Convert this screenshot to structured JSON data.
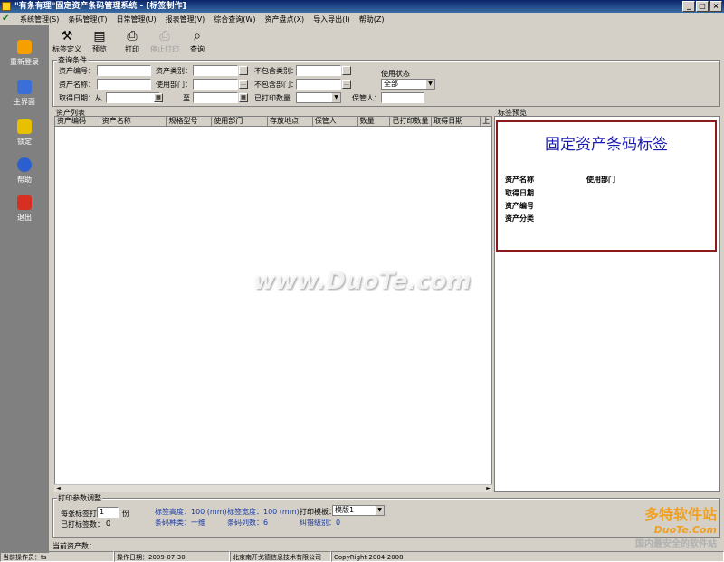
{
  "window": {
    "title": "\"有条有理\"固定资产条码管理系统 - [标签制作]",
    "buttons": [
      "_",
      "□",
      "×"
    ]
  },
  "menu": [
    "系统管理(S)",
    "条码管理(T)",
    "日常管理(U)",
    "报表管理(V)",
    "综合查询(W)",
    "资产盘点(X)",
    "导入导出(I)",
    "帮助(Z)"
  ],
  "sidebar": [
    {
      "label": "重新登录",
      "icon": "login-icon",
      "color": "#f5a000"
    },
    {
      "label": "主界面",
      "icon": "home-icon",
      "color": "#3a6fd8"
    },
    {
      "label": "锁定",
      "icon": "lock-icon",
      "color": "#e8c000"
    },
    {
      "label": "帮助",
      "icon": "help-icon",
      "color": "#2b5fd0"
    },
    {
      "label": "退出",
      "icon": "exit-icon",
      "color": "#d83020"
    }
  ],
  "toolbar": [
    {
      "label": "标签定义",
      "icon": "tools-icon",
      "glyph": "⚒",
      "enabled": true
    },
    {
      "label": "预览",
      "icon": "preview-icon",
      "glyph": "▤",
      "enabled": true
    },
    {
      "label": "打印",
      "icon": "printer-icon",
      "glyph": "⎙",
      "enabled": true
    },
    {
      "label": "停止打印",
      "icon": "stop-print-icon",
      "glyph": "⎙",
      "enabled": false
    },
    {
      "label": "查询",
      "icon": "search-icon",
      "glyph": "⌕",
      "enabled": true
    }
  ],
  "query": {
    "title": "查询条件",
    "asset_no": "资产编号：",
    "asset_name": "资产名称：",
    "get_date": "取得日期：从",
    "to": "至",
    "asset_category": "资产类别：",
    "use_dept": "使用部门：",
    "printed_count": "已打印数量",
    "exclude_category": "不包含类别：",
    "exclude_dept": "不包含部门：",
    "keeper": "保管人：",
    "use_status": "使用状态",
    "use_status_value": "全部"
  },
  "asset_list": {
    "title": "资产列表",
    "columns": [
      "资产编码",
      "资产名称",
      "规格型号",
      "使用部门",
      "存放地点",
      "保管人",
      "数量",
      "已打印数量",
      "取得日期",
      "上"
    ]
  },
  "label_preview": {
    "title": "标签预览",
    "heading": "固定资产条码标签",
    "fields": [
      "资产名称",
      "使用部门",
      "取得日期",
      "资产编号",
      "资产分类"
    ]
  },
  "print_params": {
    "title": "打印参数调整",
    "per_label": "每张标签打",
    "per_label_value": "1",
    "per_label_unit": "份",
    "printed_labels": "已打标签数：",
    "printed_labels_value": "0",
    "label_height": "标签高度：100 (mm)",
    "barcode_type": "条码种类：一维",
    "label_width": "标签宽度：100 (mm)",
    "barcode_cols": "条码列数：6",
    "print_template": "打印模板：",
    "print_template_value": "模版1",
    "error_level": "纠错级别：0"
  },
  "current_assets": "当前资产数：",
  "status": {
    "operator": "当前操作员：ts",
    "date": "操作日期：2009-07-30",
    "company": "北京南开戈德信息技术有限公司",
    "copyright": "CopyRight   2004-2008"
  },
  "watermark": {
    "center": "www.DuoTe.com",
    "corner_cn": "多特软件站",
    "corner_en": "DuoTe.Com",
    "corner_sub": "国内最安全的软件站"
  }
}
